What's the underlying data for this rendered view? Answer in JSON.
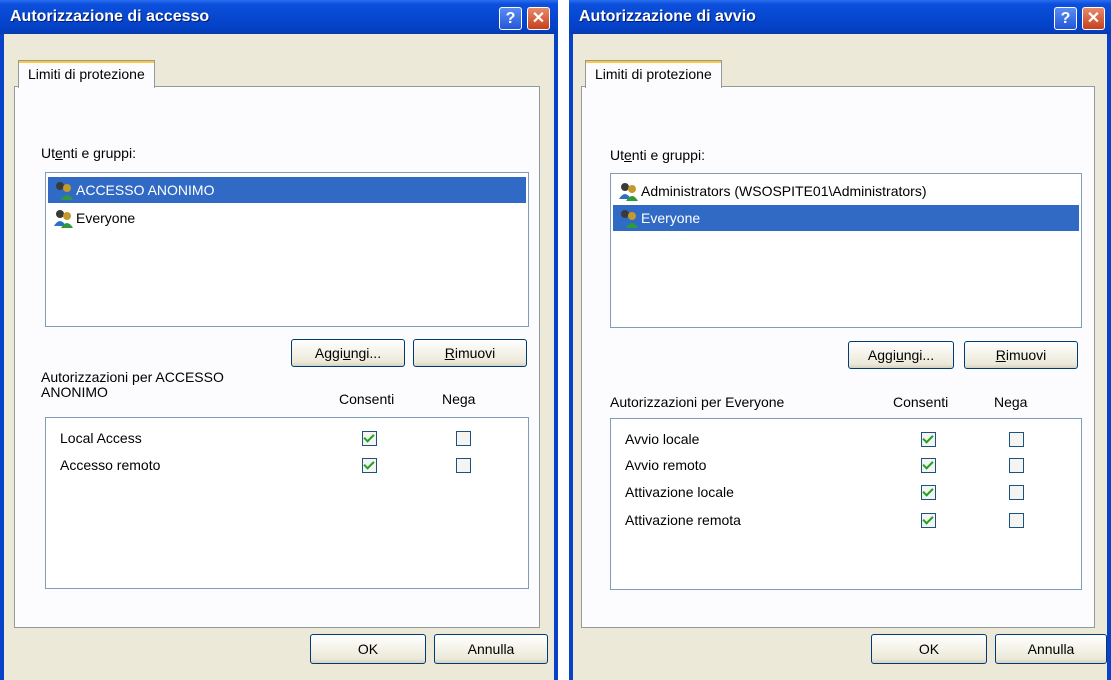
{
  "access_dialog": {
    "title": "Autorizzazione di accesso",
    "help_label": "?",
    "close_label": "✕",
    "tab_label": "Limiti di protezione",
    "users_label_pre": "Ut",
    "users_label_u": "e",
    "users_label_post": "nti e gruppi:",
    "users": [
      {
        "name": "ACCESSO ANONIMO",
        "selected": true
      },
      {
        "name": "Everyone",
        "selected": false
      }
    ],
    "add_button": {
      "pre": "Aggi",
      "u": "u",
      "post": "ngi..."
    },
    "remove_button": {
      "pre": "",
      "u": "R",
      "post": "imuovi"
    },
    "permissions_label_line1": "Autorizzazioni per ACCESSO",
    "permissions_label_line2": "ANONIMO",
    "allow_header": "Consenti",
    "deny_header": "Nega",
    "permissions": [
      {
        "name": "Local Access",
        "allow": true,
        "deny": false
      },
      {
        "name": "Accesso remoto",
        "allow": true,
        "deny": false
      }
    ],
    "ok_label": "OK",
    "cancel_label": "Annulla"
  },
  "launch_dialog": {
    "title": "Autorizzazione di avvio",
    "help_label": "?",
    "close_label": "✕",
    "tab_label": "Limiti di protezione",
    "users_label_pre": "Ut",
    "users_label_u": "e",
    "users_label_post": "nti e gruppi:",
    "users": [
      {
        "name": "Administrators (WSOSPITE01\\Administrators)",
        "selected": false
      },
      {
        "name": "Everyone",
        "selected": true
      }
    ],
    "add_button": {
      "pre": "Aggi",
      "u": "u",
      "post": "ngi..."
    },
    "remove_button": {
      "pre": "",
      "u": "R",
      "post": "imuovi"
    },
    "permissions_label": "Autorizzazioni per Everyone",
    "allow_header": "Consenti",
    "deny_header": "Nega",
    "permissions": [
      {
        "name": "Avvio locale",
        "allow": true,
        "deny": false
      },
      {
        "name": "Avvio remoto",
        "allow": true,
        "deny": false
      },
      {
        "name": "Attivazione locale",
        "allow": true,
        "deny": false
      },
      {
        "name": "Attivazione remota",
        "allow": true,
        "deny": false
      }
    ],
    "ok_label": "OK",
    "cancel_label": "Annulla"
  },
  "colors": {
    "title_bar": "#0648d0",
    "selection": "#316ac5",
    "dialog_face": "#ece9d8",
    "check": "#21a121"
  }
}
